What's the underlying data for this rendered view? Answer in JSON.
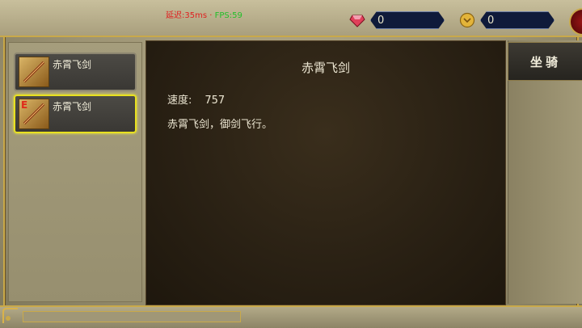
{
  "hud": {
    "ping": "延迟:35ms",
    "separator": "·",
    "fps": "FPS:59"
  },
  "resources": {
    "gems": "0",
    "gold": "0"
  },
  "list": {
    "items": [
      {
        "name": "赤霄飞剑",
        "grade": "",
        "selected": false
      },
      {
        "name": "赤霄飞剑",
        "grade": "E",
        "selected": true
      }
    ]
  },
  "detail": {
    "title": "赤霄飞剑",
    "attr_label": "速度:",
    "attr_value": "757",
    "description": "赤霄飞剑，御剑飞行。"
  },
  "tabs": {
    "mount": "坐骑"
  },
  "colors": {
    "selected_border": "#e8e020",
    "ping_color": "#e02020",
    "fps_color": "#22c02a"
  },
  "icons": {
    "gem": "red-gem-icon",
    "gold": "gold-coin-icon",
    "weapon": "flying-sword-icon"
  }
}
